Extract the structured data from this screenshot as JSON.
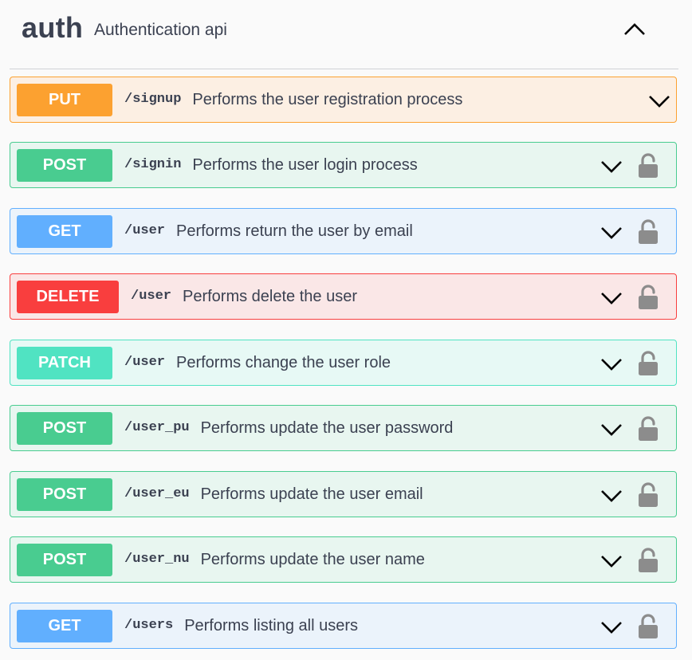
{
  "tag": {
    "name": "auth",
    "description": "Authentication api",
    "toggle_icon": "chevron-up-icon"
  },
  "operations": [
    {
      "method": "PUT",
      "path": "/signup",
      "summary": "Performs the user registration process",
      "color": "#fca130",
      "bg": "#fcefe3",
      "border": "#fca130",
      "locked": false
    },
    {
      "method": "POST",
      "path": "/signin",
      "summary": "Performs the user login process",
      "color": "#49cc90",
      "bg": "#e8f6f0",
      "border": "#49cc90",
      "locked": true
    },
    {
      "method": "GET",
      "path": "/user",
      "summary": "Performs return the user by email",
      "color": "#61affe",
      "bg": "#ebf3fb",
      "border": "#61affe",
      "locked": true
    },
    {
      "method": "DELETE",
      "path": "/user",
      "summary": "Performs delete the user",
      "color": "#f93e3e",
      "bg": "#fae7e7",
      "border": "#f93e3e",
      "locked": true
    },
    {
      "method": "PATCH",
      "path": "/user",
      "summary": "Performs change the user role",
      "color": "#50e3c2",
      "bg": "#e7f9f5",
      "border": "#50e3c2",
      "locked": true
    },
    {
      "method": "POST",
      "path": "/user_pu",
      "summary": "Performs update the user password",
      "color": "#49cc90",
      "bg": "#e8f6f0",
      "border": "#49cc90",
      "locked": true
    },
    {
      "method": "POST",
      "path": "/user_eu",
      "summary": "Performs update the user email",
      "color": "#49cc90",
      "bg": "#e8f6f0",
      "border": "#49cc90",
      "locked": true
    },
    {
      "method": "POST",
      "path": "/user_nu",
      "summary": "Performs update the user name",
      "color": "#49cc90",
      "bg": "#e8f6f0",
      "border": "#49cc90",
      "locked": true
    },
    {
      "method": "GET",
      "path": "/users",
      "summary": "Performs listing all users",
      "color": "#61affe",
      "bg": "#ebf3fb",
      "border": "#61affe",
      "locked": true
    }
  ],
  "icons": {
    "expand": "chevron-down-icon",
    "lock": "lock-icon"
  }
}
